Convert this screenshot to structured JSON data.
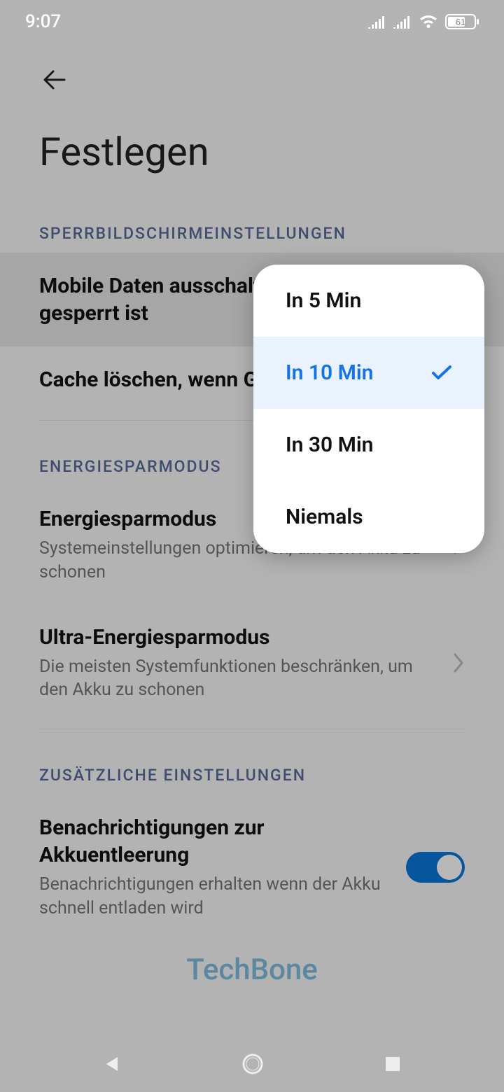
{
  "status": {
    "time": "9:07",
    "battery": "61"
  },
  "page": {
    "title": "Festlegen"
  },
  "sections": {
    "lock": {
      "label": "SPERRBILDSCHIRMEINSTELLUNGEN"
    },
    "power": {
      "label": "ENERGIESPARMODUS"
    },
    "extra": {
      "label": "ZUSÄTZLICHE EINSTELLUNGEN"
    }
  },
  "items": {
    "mobile_data": {
      "title": "Mobile Daten ausschalten wenn Gerät gesperrt ist"
    },
    "cache": {
      "title": "Cache löschen, wenn Gerät gesperrt ist"
    },
    "power_save": {
      "title": "Energiesparmodus",
      "sub": "Systemeinstellungen optimieren, um den Akku zu schonen"
    },
    "ultra_power": {
      "title": "Ultra-Energiesparmodus",
      "sub": "Die meisten Systemfunktionen beschränken, um den Akku zu schonen"
    },
    "notify": {
      "title": "Benachrichtigungen zur Akkuentleerung",
      "sub": "Benachrichtigungen erhalten wenn der Akku schnell entladen wird"
    }
  },
  "popup": {
    "options": [
      {
        "label": "In 5 Min",
        "selected": false
      },
      {
        "label": "In 10 Min",
        "selected": true
      },
      {
        "label": "In 30 Min",
        "selected": false
      },
      {
        "label": "Niemals",
        "selected": false
      }
    ]
  },
  "watermark": "TechBone"
}
